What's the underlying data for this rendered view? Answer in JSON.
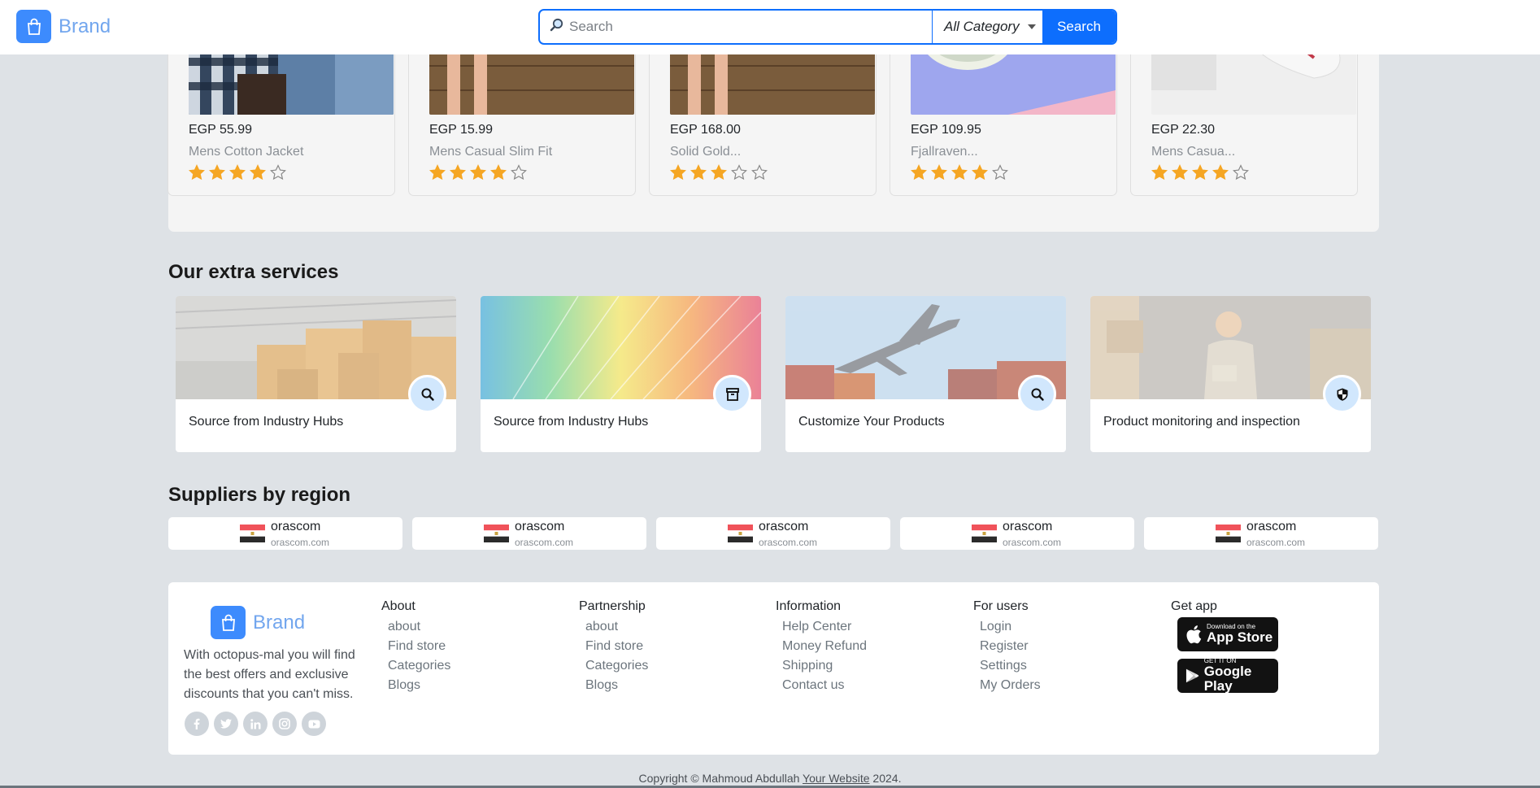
{
  "header": {
    "brand": "Brand",
    "search_placeholder": "Search",
    "category": "All Category",
    "search_button": "Search"
  },
  "products": [
    {
      "price": "EGP 55.99",
      "name": "Mens Cotton Jacket",
      "rating": 4
    },
    {
      "price": "EGP 15.99",
      "name": "Mens Casual Slim Fit",
      "rating": 4
    },
    {
      "price": "EGP 168.00",
      "name": "Solid Gold...",
      "rating": 3
    },
    {
      "price": "EGP 109.95",
      "name": "Fjallraven...",
      "rating": 4
    },
    {
      "price": "EGP 22.30",
      "name": "Mens Casua...",
      "rating": 4
    }
  ],
  "services": {
    "title": "Our extra services",
    "items": [
      {
        "title": "Source from Industry Hubs",
        "icon": "search-icon"
      },
      {
        "title": "Source from Industry Hubs",
        "icon": "archive-icon"
      },
      {
        "title": "Customize Your Products",
        "icon": "search-icon"
      },
      {
        "title": "Product monitoring and inspection",
        "icon": "shield-icon"
      }
    ]
  },
  "suppliers": {
    "title": "Suppliers by region",
    "items": [
      {
        "name": "orascom",
        "url": "orascom.com"
      },
      {
        "name": "orascom",
        "url": "orascom.com"
      },
      {
        "name": "orascom",
        "url": "orascom.com"
      },
      {
        "name": "orascom",
        "url": "orascom.com"
      },
      {
        "name": "orascom",
        "url": "orascom.com"
      }
    ]
  },
  "footer": {
    "brand": "Brand",
    "description": "With octopus-mal you will find the best offers and exclusive discounts that you can't miss.",
    "columns": [
      {
        "title": "About",
        "links": [
          "about",
          "Find store",
          "Categories",
          "Blogs"
        ]
      },
      {
        "title": "Partnership",
        "links": [
          "about",
          "Find store",
          "Categories",
          "Blogs"
        ]
      },
      {
        "title": "Information",
        "links": [
          "Help Center",
          "Money Refund",
          "Shipping",
          "Contact us"
        ]
      },
      {
        "title": "For users",
        "links": [
          "Login",
          "Register",
          "Settings",
          "My Orders"
        ]
      }
    ],
    "get_app": "Get app",
    "app_store": {
      "small": "Download on the",
      "big": "App Store"
    },
    "google_play": {
      "small": "GET IT ON",
      "big": "Google Play"
    },
    "socials": [
      "facebook-icon",
      "twitter-icon",
      "linkedin-icon",
      "instagram-icon",
      "youtube-icon"
    ]
  },
  "copyright": {
    "prefix": "Copyright © Mahmoud Abdullah ",
    "link": "Your Website",
    "suffix": " 2024."
  },
  "colors": {
    "accent": "#0d6efd",
    "star": "#f5a623",
    "page_bg": "#dee2e6"
  }
}
